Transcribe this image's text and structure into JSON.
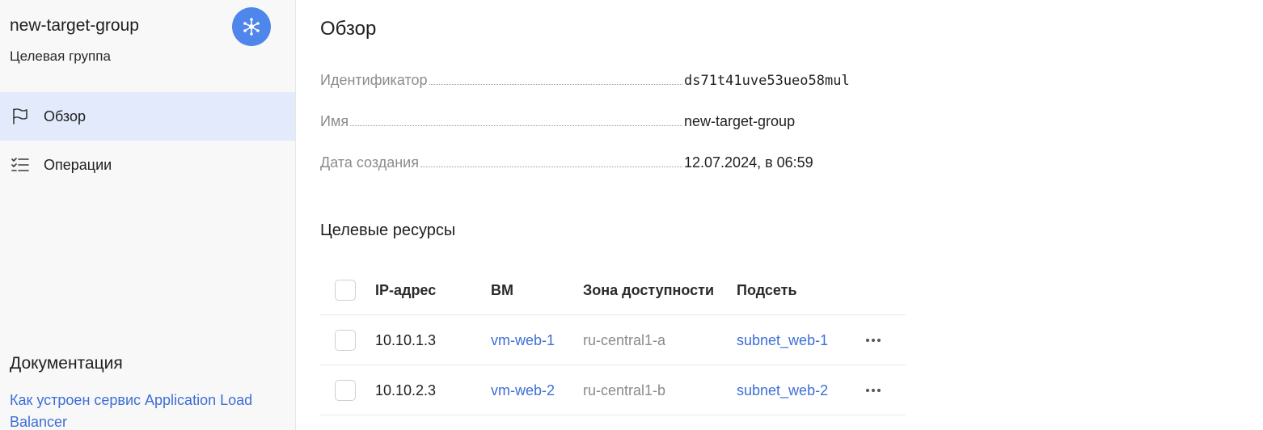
{
  "sidebar": {
    "title": "new-target-group",
    "subtitle": "Целевая группа",
    "service_icon": "network-hub-icon",
    "accent": "#4f86ec",
    "nav": [
      {
        "label": "Обзор",
        "icon": "flag-icon",
        "active": true
      },
      {
        "label": "Операции",
        "icon": "checklist-icon",
        "active": false
      }
    ],
    "docs": {
      "title": "Документация",
      "link": "Как устроен сервис Application Load Balancer"
    }
  },
  "main": {
    "title": "Обзор",
    "properties": [
      {
        "key": "Идентификатор",
        "value": "ds71t41uve53ueo58mul"
      },
      {
        "key": "Имя",
        "value": "new-target-group"
      },
      {
        "key": "Дата создания",
        "value": "12.07.2024, в 06:59"
      }
    ],
    "resources": {
      "title": "Целевые ресурсы",
      "columns": [
        "IP-адрес",
        "ВМ",
        "Зона доступности",
        "Подсеть"
      ],
      "rows": [
        {
          "ip": "10.10.1.3",
          "vm": "vm-web-1",
          "zone": "ru-central1-a",
          "subnet": "subnet_web-1"
        },
        {
          "ip": "10.10.2.3",
          "vm": "vm-web-2",
          "zone": "ru-central1-b",
          "subnet": "subnet_web-2"
        }
      ]
    }
  },
  "colors": {
    "link": "#3d6ed6",
    "active_nav_bg": "#e3eafb",
    "sidebar_bg": "#f8f8f8"
  }
}
